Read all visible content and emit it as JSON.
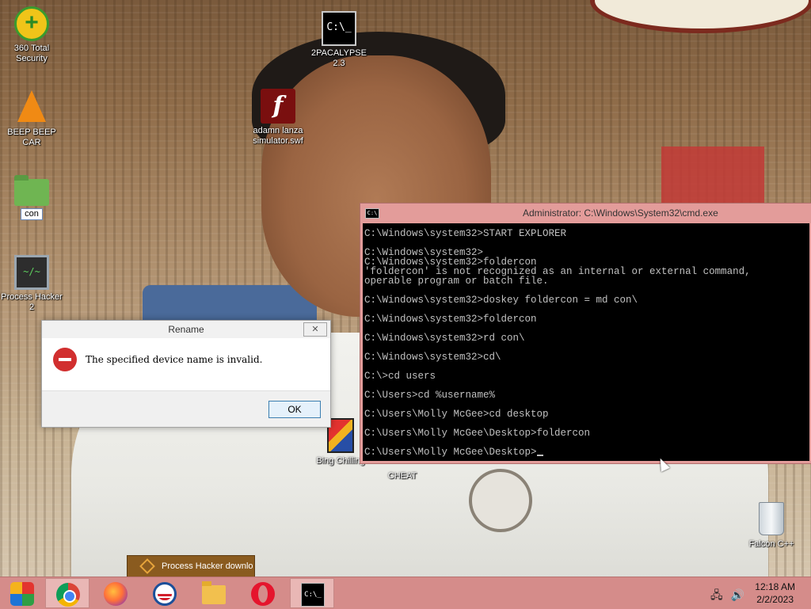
{
  "desktop_icons": [
    {
      "id": "360",
      "label": "360 Total Security",
      "icon": "360-security-icon"
    },
    {
      "id": "2pac",
      "label": "2PACALYPSE 2.3",
      "icon": "cmd-icon"
    },
    {
      "id": "flash",
      "label": "adamn lanza simulator.swf",
      "icon": "flash-icon"
    },
    {
      "id": "vlc",
      "label": "BEEP BEEP CAR",
      "icon": "vlc-cone-icon"
    },
    {
      "id": "con",
      "label": "con",
      "icon": "folder-icon"
    },
    {
      "id": "ph",
      "label": "Process Hacker 2",
      "icon": "process-hacker-icon"
    },
    {
      "id": "bing",
      "label": "Bing Chilling",
      "icon": "game-box-icon"
    },
    {
      "id": "cheat",
      "label": "CHEAT",
      "icon": "none"
    },
    {
      "id": "falcon",
      "label": "Falcon C++",
      "icon": "recycle-bin-icon"
    }
  ],
  "dialog": {
    "title": "Rename",
    "close_glyph": "✕",
    "message": "The specified device name is invalid.",
    "ok_label": "OK"
  },
  "cmd": {
    "title": "Administrator: C:\\Windows\\System32\\cmd.exe",
    "title_icon": "C:\\",
    "lines": [
      "C:\\Windows\\system32>START EXPLORER",
      "",
      "C:\\Windows\\system32>",
      "C:\\Windows\\system32>foldercon",
      "'foldercon' is not recognized as an internal or external command,",
      "operable program or batch file.",
      "",
      "C:\\Windows\\system32>doskey foldercon = md con\\",
      "",
      "C:\\Windows\\system32>foldercon",
      "",
      "C:\\Windows\\system32>rd con\\",
      "",
      "C:\\Windows\\system32>cd\\",
      "",
      "C:\\>cd users",
      "",
      "C:\\Users>cd %username%",
      "",
      "C:\\Users\\Molly McGee>cd desktop",
      "",
      "C:\\Users\\Molly McGee\\Desktop>foldercon",
      "",
      "C:\\Users\\Molly McGee\\Desktop>"
    ]
  },
  "toast": {
    "text": "Process Hacker downlo"
  },
  "taskbar": {
    "apps": [
      "start",
      "chrome",
      "firefox",
      "obama",
      "file-explorer",
      "opera",
      "cmd"
    ],
    "cmd_label": "C:\\_",
    "time": "12:18 AM",
    "date": "2/2/2023"
  }
}
